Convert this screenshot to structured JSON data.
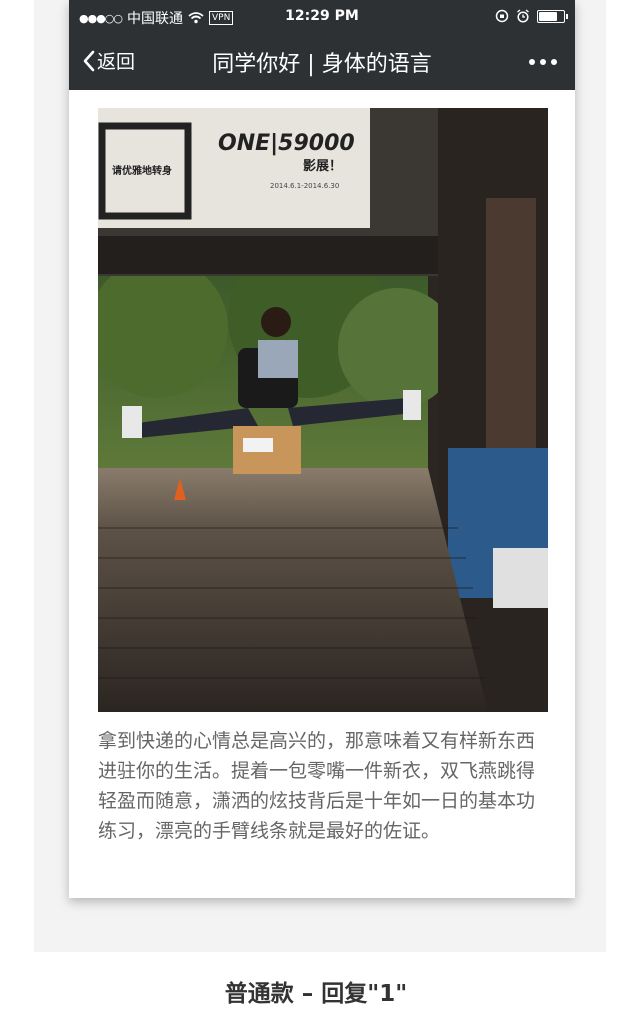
{
  "status_bar": {
    "signal": "●●●○○",
    "carrier": "中国联通",
    "wifi_icon": "wifi-icon",
    "vpn": "VPN",
    "time": "12:29 PM",
    "battery_level": 0.8
  },
  "nav": {
    "back_label": "返回",
    "title": "同学你好 | 身体的语言",
    "more_icon": "more-icon"
  },
  "article": {
    "photo_banner": {
      "title": "ONE|59000",
      "subtitle": "影展！",
      "dates": "2014.6.1-2014.6.30",
      "side_text": "请优雅地转身"
    },
    "caption": "拿到快递的心情总是高兴的，那意味着又有样新东西进驻你的生活。提着一包零嘴一件新衣，双飞燕跳得轻盈而随意，潇洒的炫技背后是十年如一日的基本功练习，漂亮的手臂线条就是最好的佐证。"
  },
  "page_label": "普通款 – 回复\"1\""
}
